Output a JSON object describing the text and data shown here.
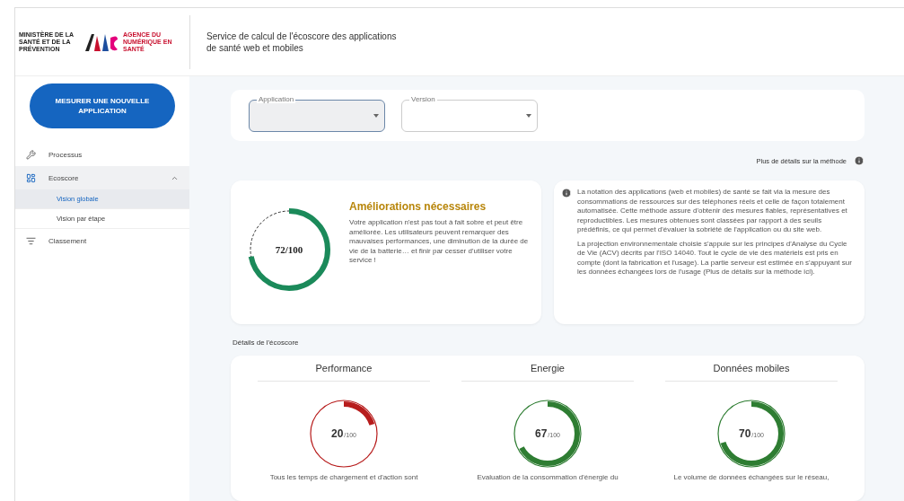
{
  "header": {
    "ministry": "MINISTÈRE DE LA SANTÉ ET DE LA PRÉVENTION",
    "agency": "AGENCE DU NUMÉRIQUE EN SANTÉ",
    "title": "Service de calcul de l'écoscore des applications de santé web et mobiles"
  },
  "sidebar": {
    "button": "MESURER UNE NOUVELLE APPLICATION",
    "items": [
      {
        "label": "Processus",
        "expanded": false
      },
      {
        "label": "Ecoscore",
        "expanded": true,
        "children": [
          {
            "label": "Vision globale",
            "selected": true
          },
          {
            "label": "Vision par étape",
            "selected": false
          }
        ]
      },
      {
        "label": "Classement",
        "expanded": false
      }
    ]
  },
  "filters": [
    {
      "label": "Application",
      "focused": true
    },
    {
      "label": "Version",
      "focused": false
    }
  ],
  "method_link": "Plus de détails sur la méthode",
  "summary": {
    "score": "72/100",
    "level": 0.72,
    "title": "Améliorations nécessaires",
    "text": "Votre application n'est pas tout à fait sobre et peut être améliorée. Les utilisateurs peuvent remarquer des mauvaises performances, une diminution de la durée de vie de la batterie… et finir par cesser d'utiliser votre service !"
  },
  "info": [
    "La notation des applications (web et mobiles) de santé se fait via la mesure des consommations de ressources sur des téléphones réels et celle de façon totalement automatisée. Cette méthode assure d'obtenir des mesures fiables, représentatives et reproductibles. Les mesures obtenues sont classées par rapport à des seuils prédéfinis, ce qui permet d'évaluer la sobriété de l'application ou du site web.",
    "La projection environnementale choisie s'appuie sur les principes d'Analyse du Cycle de Vie (ACV) décrits par l'ISO 14040. Tout le cycle de vie des matériels est pris en compte (dont la fabrication et l'usage). La partie serveur est estimée en s'appuyant sur les données échangées lors de l'usage (Plus de détails sur la méthode ici)."
  ],
  "details_title": "Détails de l'écoscore",
  "details": [
    {
      "title": "Performance",
      "score": "20",
      "unit": "/100",
      "level": 0.2,
      "color": "#b71c1c",
      "text": "Tous les temps de chargement et d'action sont"
    },
    {
      "title": "Energie",
      "score": "67",
      "unit": "/100",
      "level": 0.67,
      "color": "#2e7d32",
      "text": "Evaluation de la consommation d'énergie du"
    },
    {
      "title": "Données mobiles",
      "score": "70",
      "unit": "/100",
      "level": 0.7,
      "color": "#2e7d32",
      "text": "Le volume de données échangées sur le réseau,"
    }
  ]
}
